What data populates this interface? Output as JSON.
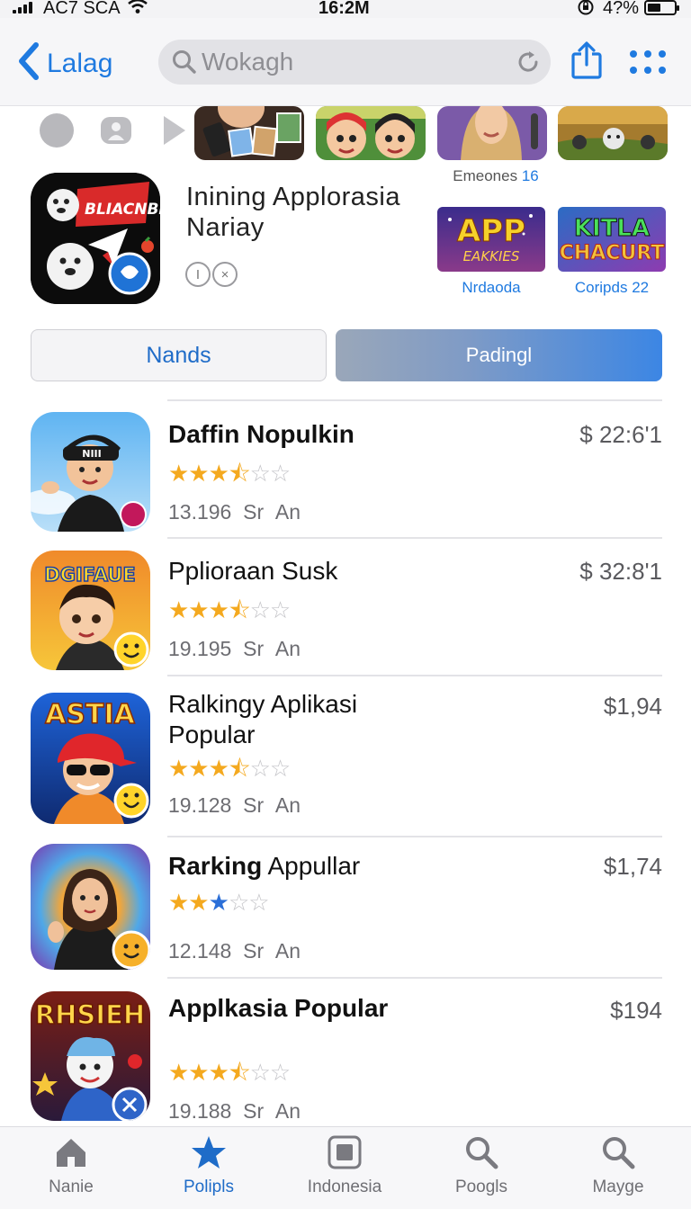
{
  "status_bar": {
    "carrier": "AC7 SCA",
    "time": "16:2M",
    "battery": "4?%"
  },
  "nav": {
    "back_label": "Lalag",
    "search_placeholder": "Wokagh"
  },
  "thumbnails": {
    "top_right_caption": "Emeones",
    "top_right_count": "16",
    "banners": [
      {
        "art_text_1": "APP",
        "art_text_2": "EAKKIES",
        "caption": "Nrdaoda"
      },
      {
        "art_text_1": "KITLA",
        "art_text_2": "CHACURT",
        "caption": "Coripds 22"
      }
    ]
  },
  "featured": {
    "icon_text": "BLIACNBR",
    "title": "Inining Applorasia Nariay"
  },
  "segments": {
    "left": "Nands",
    "right": "Padingl"
  },
  "apps": [
    {
      "name_bold": "Daffin Nopulkin",
      "name_regular": "",
      "price": "$ 22:6'1",
      "rating": 3.5,
      "meta_count": "13.196",
      "meta_unit": "Sr",
      "meta_suffix": "An",
      "icon_text": "NIII"
    },
    {
      "name_bold": "",
      "name_regular": "Pplioraan Susk",
      "price": "$ 32:8'1",
      "rating": 3.5,
      "meta_count": "19.195",
      "meta_unit": "Sr",
      "meta_suffix": "An",
      "icon_text": "DGIFAUE"
    },
    {
      "name_bold": "",
      "name_regular": "Ralkingy Aplikasi Popular",
      "price": "$1,94",
      "rating": 3.5,
      "meta_count": "19.128",
      "meta_unit": "Sr",
      "meta_suffix": "An",
      "icon_text": "ASTIA"
    },
    {
      "name_bold": "Rarking",
      "name_regular": " Appullar",
      "price": "$1,74",
      "rating": 2.5,
      "meta_count": "12.148",
      "meta_unit": "Sr",
      "meta_suffix": "An",
      "icon_text": ""
    },
    {
      "name_bold": "Applkasia Popular",
      "name_regular": "",
      "price": "$194",
      "rating": 3.5,
      "meta_count": "19.188",
      "meta_unit": "Sr",
      "meta_suffix": "An",
      "icon_text": "RHSIEH"
    }
  ],
  "tabs": [
    {
      "label": "Nanie",
      "icon": "home-icon",
      "active": false
    },
    {
      "label": "Polipls",
      "icon": "star-icon",
      "active": true
    },
    {
      "label": "Indonesia",
      "icon": "square-icon",
      "active": false
    },
    {
      "label": "Poogls",
      "icon": "search-icon",
      "active": false
    },
    {
      "label": "Mayge",
      "icon": "search-icon",
      "active": false
    }
  ],
  "colors": {
    "accent": "#1f7ae0",
    "star": "#f4a91f",
    "star_empty": "#c4c4c8",
    "star_blue": "#2b6fd8"
  }
}
